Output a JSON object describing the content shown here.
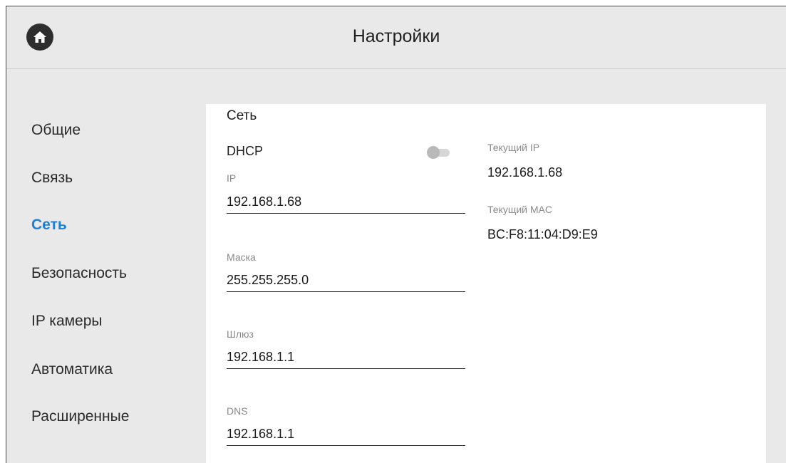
{
  "header": {
    "title": "Настройки",
    "home_icon": "home-icon"
  },
  "sidebar": {
    "items": [
      {
        "label": "Общие",
        "active": false
      },
      {
        "label": "Связь",
        "active": false
      },
      {
        "label": "Сеть",
        "active": true
      },
      {
        "label": "Безопасность",
        "active": false
      },
      {
        "label": "IP камеры",
        "active": false
      },
      {
        "label": "Автоматика",
        "active": false
      },
      {
        "label": "Расширенные",
        "active": false
      }
    ]
  },
  "network": {
    "section_title": "Сеть",
    "dhcp_label": "DHCP",
    "dhcp_enabled": false,
    "ip_label": "IP",
    "ip_value": "192.168.1.68",
    "mask_label": "Маска",
    "mask_value": "255.255.255.0",
    "gateway_label": "Шлюз",
    "gateway_value": "192.168.1.1",
    "dns_label": "DNS",
    "dns_value": "192.168.1.1",
    "current_ip_label": "Текущий IP",
    "current_ip_value": "192.168.1.68",
    "current_mac_label": "Текущий MAC",
    "current_mac_value": "BC:F8:11:04:D9:E9"
  },
  "colors": {
    "accent": "#1f7fd8",
    "background": "#e9e9e9",
    "panel": "#ffffff"
  }
}
